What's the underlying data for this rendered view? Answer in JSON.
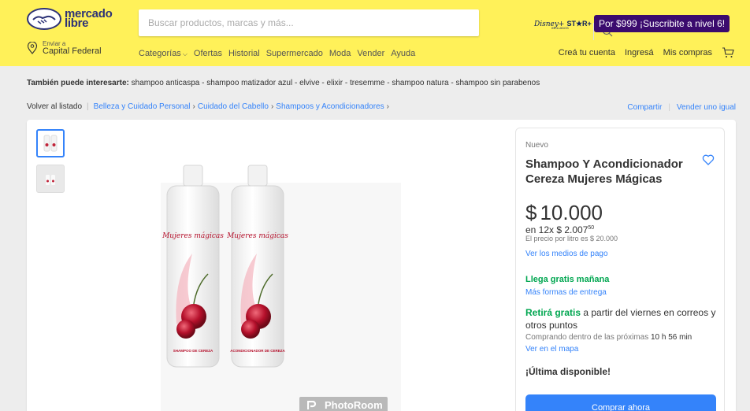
{
  "header": {
    "logo_line1": "mercado",
    "logo_line2": "libre",
    "search_placeholder": "Buscar productos, marcas y más...",
    "disney_logo": "Disney+",
    "star_logo": "ST★R+",
    "disney_sub": "INCLUIDOS",
    "promo_text": "Por $999 ¡Suscribite a nivel 6!",
    "location_label": "Enviar a",
    "location_value": "Capital Federal",
    "nav": [
      "Categorías",
      "Ofertas",
      "Historial",
      "Supermercado",
      "Moda",
      "Vender",
      "Ayuda"
    ],
    "user_nav": [
      "Creá tu cuenta",
      "Ingresá",
      "Mis compras"
    ]
  },
  "related": {
    "label": "También puede interesarte:",
    "items": "shampoo anticaspa - shampoo matizador azul - elvive - elixir - tresemme - shampoo natura - shampoo sin parabenos"
  },
  "breadcrumb": {
    "back": "Volver al listado",
    "items": [
      "Belleza y Cuidado Personal",
      "Cuidado del Cabello",
      "Shampoos y Acondicionadores"
    ],
    "share": "Compartir",
    "sell": "Vender uno igual"
  },
  "product": {
    "condition": "Nuevo",
    "title": "Shampoo Y Acondicionador Cereza Mujeres Mágicas",
    "currency": "$",
    "price": "10.000",
    "installments_prefix": "en 12x $ 2.007",
    "installments_cents": "50",
    "per_liter": "El precio por litro es $ 20.000",
    "payment_link": "Ver los medios de pago",
    "shipping": "Llega gratis mañana",
    "more_shipping": "Más formas de entrega",
    "pickup_bold": "Retirá gratis",
    "pickup_rest": " a partir del viernes en correos y otros puntos",
    "countdown_prefix": "Comprando dentro de las próximas ",
    "countdown_value": "10 h 56 min",
    "map_link": "Ver en el mapa",
    "stock": "¡Última disponible!",
    "buy_button": "Comprar ahora",
    "bottle_label_brand": "Mujeres mágicas",
    "bottle1_label": "SHAMPOO DE CEREZA",
    "bottle2_label": "ACONDICIONADOR DE CEREZA",
    "watermark": "PhotoRoom"
  },
  "colors": {
    "header_bg": "#fff159",
    "accent_blue": "#3483fa",
    "green": "#00a650",
    "promo_bg": "#3b0b6e"
  }
}
